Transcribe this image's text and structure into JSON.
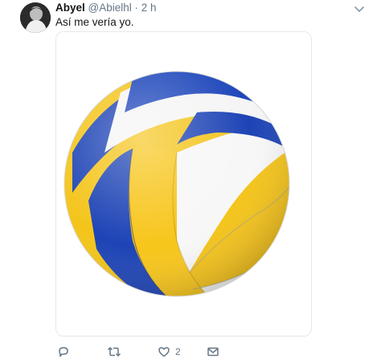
{
  "tweet": {
    "author_name": "Abyel",
    "handle": "@Abielhl",
    "separator": "·",
    "time": "2 h",
    "text": "Así me vería yo.",
    "actions": {
      "reply_icon": "reply-icon",
      "retweet_icon": "retweet-icon",
      "like_icon": "like-icon",
      "like_count": "2",
      "message_icon": "message-icon"
    }
  },
  "colors": {
    "name": "#14171a",
    "meta": "#657786",
    "ball_blue": "#1f46b8",
    "ball_yellow": "#f7c51a",
    "ball_white": "#f7f7f7"
  }
}
